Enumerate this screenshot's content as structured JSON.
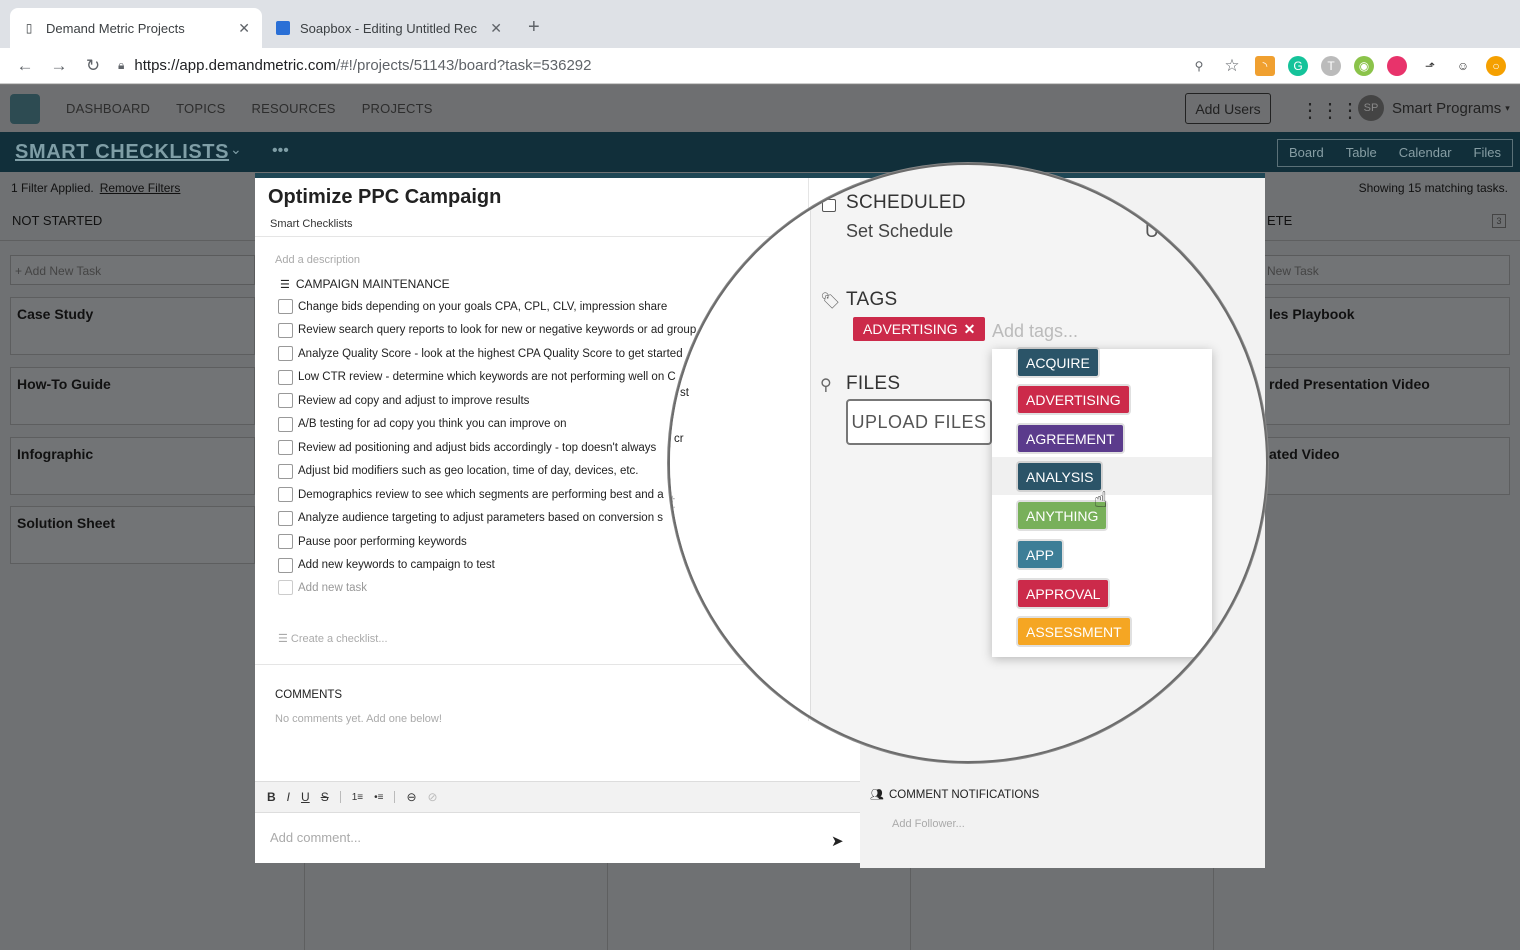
{
  "browser": {
    "tabs": [
      {
        "title": "Demand Metric Projects",
        "icon": "page-icon"
      },
      {
        "title": "Soapbox - Editing Untitled Rec",
        "icon": "soapbox-icon"
      }
    ],
    "url_host": "https://app.demandmetric.com",
    "url_path": "/#!/projects/51143/board?task=536292"
  },
  "appbar": {
    "nav": [
      "DASHBOARD",
      "TOPICS",
      "RESOURCES",
      "PROJECTS"
    ],
    "add_users": "Add Users",
    "avatar_initials": "SP",
    "user_name": "Smart Programs"
  },
  "board": {
    "title": "SMART CHECKLISTS",
    "more": "•••",
    "views": [
      "Board",
      "Table",
      "Calendar",
      "Files"
    ],
    "filter_text": "1 Filter Applied.",
    "remove_filters": "Remove Filters",
    "matching": "Showing 15 matching tasks.",
    "left_column": {
      "header": "NOT STARTED",
      "add_task": "+ Add New Task",
      "cards": [
        "Case Study",
        "How-To Guide",
        "Infographic",
        "Solution Sheet"
      ]
    },
    "right_column": {
      "header": "ETE",
      "count": "3",
      "add_task": "New Task",
      "cards": [
        "les Playbook",
        "rded Presentation Video",
        "ated Video"
      ]
    }
  },
  "modal": {
    "title": "Optimize PPC Campaign",
    "subtitle": "Smart Checklists",
    "description_placeholder": "Add a description",
    "checklist_title": "CAMPAIGN MAINTENANCE",
    "checklist": [
      "Change bids depending on your goals CPA, CPL, CLV, impression share",
      "Review search query reports to look for new or negative keywords or ad group",
      "Analyze Quality Score - look at the highest CPA Quality Score to get started",
      "Low CTR review - determine which keywords are not performing well on C",
      "Review ad copy and adjust to improve results",
      "A/B testing for ad copy you think you can improve on",
      "Review ad positioning and adjust bids accordingly - top doesn't always",
      "Adjust bid modifiers such as geo location, time of day, devices, etc.",
      "Demographics review to see which segments are performing best and a",
      "Analyze audience targeting to adjust parameters based on conversion s",
      "Pause poor performing keywords",
      "Add new keywords to campaign to test"
    ],
    "add_new_task": "Add new task",
    "create_checklist": "Create a checklist...",
    "comments_title": "COMMENTS",
    "comments_empty": "No comments yet. Add one below!",
    "editor_tools": [
      "B",
      "I",
      "U",
      "S",
      "1≡",
      "•≡",
      "⊖",
      "⊘"
    ],
    "comment_placeholder": "Add comment...",
    "notifications_title": "COMMENT NOTIFICATIONS",
    "add_follower": "Add Follower..."
  },
  "lens": {
    "scheduled_label": "SCHEDULED",
    "set_schedule": "Set Schedule",
    "partial_right": "U",
    "tags_label": "TAGS",
    "current_tag": "ADVERTISING",
    "add_tags_placeholder": "Add tags...",
    "files_label": "FILES",
    "upload_button": "UPLOAD FILES",
    "tag_options": [
      {
        "label": "ACQUIRE",
        "color": "#2b5468"
      },
      {
        "label": "ADVERTISING",
        "color": "#cc2a4a"
      },
      {
        "label": "AGREEMENT",
        "color": "#5b3b8c"
      },
      {
        "label": "ANALYSIS",
        "color": "#2b5468"
      },
      {
        "label": "ANYTHING",
        "color": "#78b05a"
      },
      {
        "label": "APP",
        "color": "#3d7e97"
      },
      {
        "label": "APPROVAL",
        "color": "#cc2a4a"
      },
      {
        "label": "ASSESSMENT",
        "color": "#f5a623"
      }
    ],
    "snippets": [
      "mpr",
      "ord",
      "st",
      "st",
      "cr",
      "t",
      "i"
    ]
  },
  "colors": {
    "header_dark": "#112f3a",
    "modal_accent": "#1f4755",
    "overlay": "#6f7173"
  }
}
